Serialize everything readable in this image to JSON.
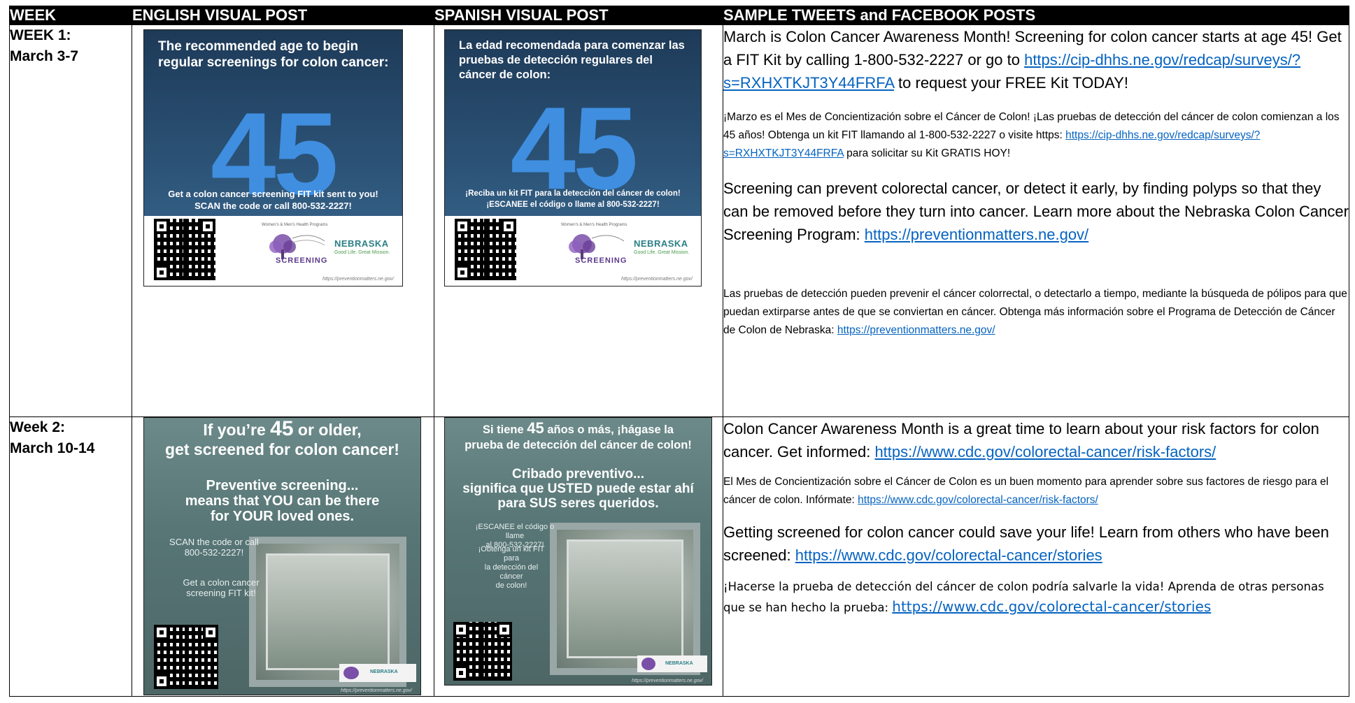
{
  "headers": {
    "week": "WEEK",
    "english": "ENGLISH VISUAL POST",
    "spanish": "SPANISH VISUAL POST",
    "posts": "SAMPLE TWEETS and FACEBOOK POSTS"
  },
  "week1": {
    "label": "WEEK 1:",
    "dates": "March 3-7",
    "english_post": {
      "headline": "The recommended age to begin regular screenings for colon cancer:",
      "number": "45",
      "cta_line1": "Get a colon cancer screening FIT kit sent to you!",
      "cta_line2": "SCAN the code or call 800-532-2227!",
      "logo_small": "Women's & Men's Health Programs",
      "logo_word": "SCREENING",
      "nebraska": "NEBRASKA",
      "tagline": "Good Life. Great Mission.",
      "url": "https://preventionmatters.ne.gov/"
    },
    "spanish_post": {
      "headline": "La edad recomendada para comenzar las pruebas de detección regulares del cáncer de colon:",
      "number": "45",
      "cta_line1": "¡Reciba un kit FIT para la detección del cáncer de colon!",
      "cta_line2": "¡ESCANEE el código o llame al 800-532-2227!",
      "logo_small": "Women's & Men's Health Programs",
      "logo_word": "SCREENING",
      "nebraska": "NEBRASKA",
      "tagline": "Good Life. Great Mission.",
      "url": "https://preventionmatters.ne.gov/"
    },
    "post1_text": "March is Colon Cancer Awareness Month!  Screening for colon cancer starts at age 45!  Get a FIT Kit by calling 1-800-532-2227 or go to ",
    "post1_link": "https://cip-dhhs.ne.gov/redcap/surveys/?s=RXHXTKJT3Y44FRFA",
    "post1_tail": " to request your FREE Kit TODAY!",
    "post2_text": "¡Marzo es el Mes de Concientización sobre el Cáncer de Colon! ¡Las pruebas de detección del cáncer de colon comienzan a los 45 años! Obtenga un kit FIT llamando al 1-800-532-2227 o visite https: ",
    "post2_link": "https://cip-dhhs.ne.gov/redcap/surveys/?s=RXHXTKJT3Y44FRFA",
    "post2_tail": " para solicitar su Kit GRATIS HOY!",
    "post3_text": "Screening can prevent colorectal cancer, or detect it early, by finding polyps so that they can be removed before they turn into cancer. Learn more about the Nebraska Colon Cancer Screening Program:  ",
    "post3_link": "https://preventionmatters.ne.gov/",
    "post4_text": "Las pruebas de detección pueden prevenir el cáncer colorrectal, o detectarlo a tiempo, mediante la búsqueda de pólipos para que puedan extirparse antes de que se conviertan en cáncer. Obtenga más información sobre el Programa de Detección de Cáncer de Colon de Nebraska: ",
    "post4_link": "https://preventionmatters.ne.gov/"
  },
  "week2": {
    "label": "Week 2:",
    "dates": "March 10-14",
    "english_post": {
      "headline_a": "If you’re ",
      "headline_num": "45",
      "headline_b": " or older,",
      "headline_c": "get screened for colon cancer!",
      "sub1": "Preventive screening...",
      "sub2": "means that YOU can be there",
      "sub3": "for YOUR loved ones.",
      "scan1": "SCAN the code or call",
      "scan2": "800-532-2227!",
      "kit1": "Get a colon cancer",
      "kit2": "screening FIT kit!",
      "nebraska": "NEBRASKA",
      "url": "https://preventionmatters.ne.gov/"
    },
    "spanish_post": {
      "headline_a": "Si tiene ",
      "headline_num": "45",
      "headline_b": " años o más, ¡hágase la",
      "headline_c": "prueba de detección del cáncer de colon!",
      "sub1": "Cribado preventivo...",
      "sub2": "significa que USTED puede estar ahí",
      "sub3": "para SUS seres queridos.",
      "scan1": "¡ESCANEE el código o llame",
      "scan2": "al 800-532-2227!",
      "kit1": "¡Obtenga un kit FIT para",
      "kit2": "la detección del cáncer",
      "kit3": "de colon!",
      "nebraska": "NEBRASKA",
      "url": "https://preventionmatters.ne.gov/"
    },
    "post1_text": "Colon Cancer Awareness Month is a great time to learn about your risk factors for colon cancer.  Get informed:  ",
    "post1_link": "https://www.cdc.gov/colorectal-cancer/risk-factors/",
    "post2_text": "El Mes de Concientización sobre el Cáncer de Colon es un buen momento para aprender sobre sus factores de riesgo para el cáncer de colon. Infórmate: ",
    "post2_link": "https://www.cdc.gov/colorectal-cancer/risk-factors/",
    "post3_text": "Getting screened for colon cancer could save your life! Learn from others who have been screened: ",
    "post3_link": "https://www.cdc.gov/colorectal-cancer/stories",
    "post4_text": "¡Hacerse la prueba de detección del cáncer de colon podría salvarle la vida! Aprenda de otras personas que se han hecho la prueba: ",
    "post4_link": "https://www.cdc.gov/colorectal-cancer/stories"
  },
  "colors": {
    "header_bg": "#000000",
    "link": "#0563c1",
    "poster_blue": "#3f8ee0",
    "poster_teal": "#587676"
  }
}
